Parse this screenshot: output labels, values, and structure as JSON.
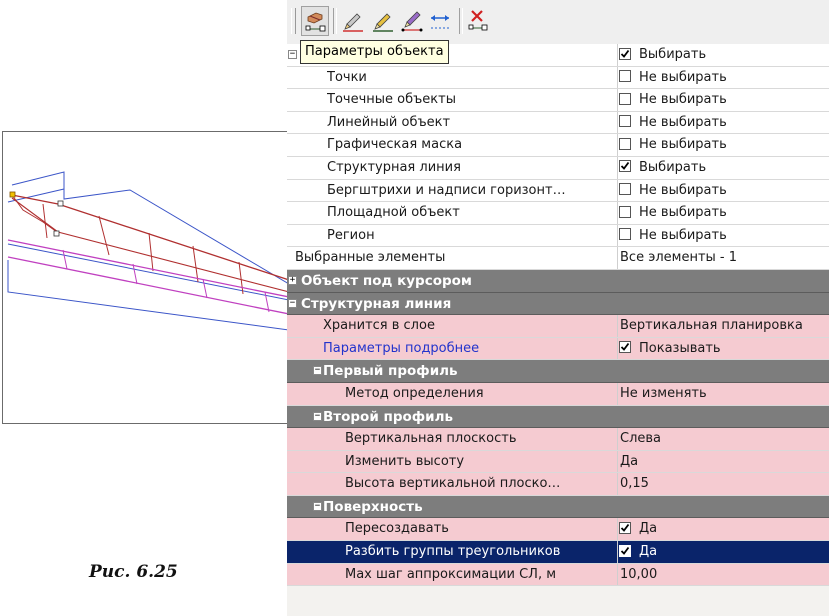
{
  "toolbar": {
    "buttons": [
      {
        "icon": "object-params-icon",
        "active": true
      },
      {
        "icon": "pencil-edit-icon"
      },
      {
        "icon": "pencil-line-icon"
      },
      {
        "icon": "pencil-node-icon"
      },
      {
        "icon": "arrows-horizontal-icon"
      },
      {
        "icon": "delete-object-icon"
      }
    ],
    "tooltip": "Параметры объекта"
  },
  "caption": "Рис. 6.25",
  "rows": [
    {
      "type": "item",
      "expander": "−",
      "label": "В",
      "value": "Выбирать",
      "checked": true,
      "style": "plain",
      "indent": 14
    },
    {
      "type": "item",
      "label": "Точки",
      "value": "Не выбирать",
      "checked": false,
      "style": "plain",
      "indent": 40
    },
    {
      "type": "item",
      "label": "Точечные объекты",
      "value": "Не выбирать",
      "checked": false,
      "style": "plain",
      "indent": 40
    },
    {
      "type": "item",
      "label": "Линейный объект",
      "value": "Не выбирать",
      "checked": false,
      "style": "plain",
      "indent": 40
    },
    {
      "type": "item",
      "label": "Графическая маска",
      "value": "Не выбирать",
      "checked": false,
      "style": "plain",
      "indent": 40
    },
    {
      "type": "item",
      "label": "Структурная линия",
      "value": "Выбирать",
      "checked": true,
      "style": "plain",
      "indent": 40
    },
    {
      "type": "item",
      "label": "Бергштрихи и надписи горизонт…",
      "value": "Не выбирать",
      "checked": false,
      "style": "plain",
      "indent": 40
    },
    {
      "type": "item",
      "label": "Площадной объект",
      "value": "Не выбирать",
      "checked": false,
      "style": "plain",
      "indent": 40
    },
    {
      "type": "item",
      "label": "Регион",
      "value": "Не выбирать",
      "checked": false,
      "style": "plain",
      "indent": 40
    },
    {
      "type": "item",
      "label": "Выбранные элементы",
      "value": "Все элементы - 1",
      "style": "plain",
      "indent": 8
    },
    {
      "type": "cat",
      "expander": "+",
      "label": "Объект под курсором",
      "indent": 14
    },
    {
      "type": "cat",
      "expander": "−",
      "label": "Структурная линия",
      "indent": 14
    },
    {
      "type": "item",
      "label": "Хранится в слое",
      "value": "Вертикальная планировка",
      "style": "pink",
      "indent": 36
    },
    {
      "type": "item",
      "label": "Параметры подробнее",
      "value": "Показывать",
      "checked": true,
      "style": "pink",
      "indent": 36,
      "link": true
    },
    {
      "type": "cat",
      "expander": "−",
      "label": "Первый профиль",
      "indent": 36,
      "expX": 26
    },
    {
      "type": "item",
      "label": "Метод определения",
      "value": "Не изменять",
      "style": "pink",
      "indent": 58
    },
    {
      "type": "cat",
      "expander": "−",
      "label": "Второй профиль",
      "indent": 36,
      "expX": 26
    },
    {
      "type": "item",
      "label": "Вертикальная плоскость",
      "value": "Слева",
      "style": "pink",
      "indent": 58
    },
    {
      "type": "item",
      "label": "Изменить высоту",
      "value": "Да",
      "style": "pink",
      "indent": 58
    },
    {
      "type": "item",
      "label": "Высота вертикальной плоско…",
      "value": "0,15",
      "style": "pink",
      "indent": 58
    },
    {
      "type": "cat",
      "expander": "−",
      "label": "Поверхность",
      "indent": 36,
      "expX": 26
    },
    {
      "type": "item",
      "label": "Пересоздавать",
      "value": "Да",
      "checked": true,
      "style": "pink",
      "indent": 58
    },
    {
      "type": "item",
      "label": "Разбить группы треугольников",
      "value": "Да",
      "checked": true,
      "style": "sel",
      "indent": 58
    },
    {
      "type": "item",
      "label": "Max шаг аппроксимации СЛ, м",
      "value": "10,00",
      "style": "pink",
      "indent": 58
    }
  ]
}
